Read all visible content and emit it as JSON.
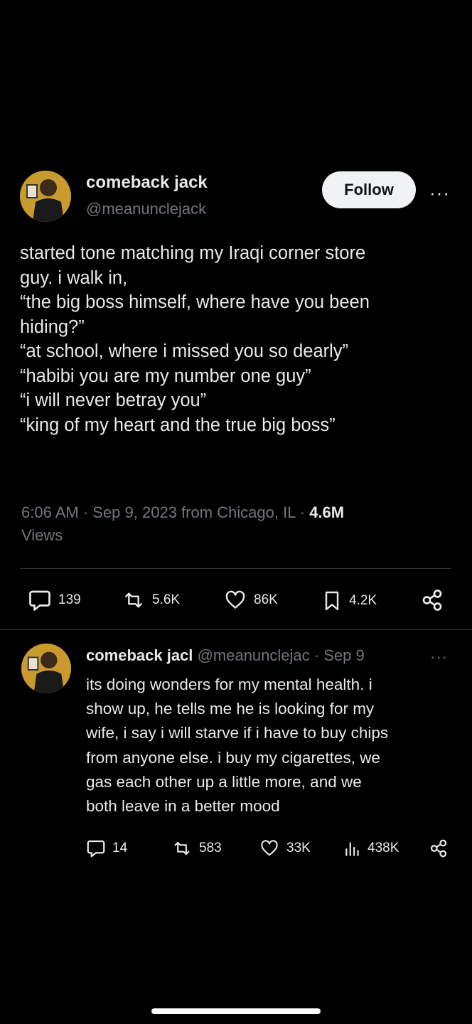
{
  "tweet": {
    "author_name": "comeback jack",
    "author_handle": "@meanunclejack",
    "follow_label": "Follow",
    "more_label": "···",
    "text": "started tone matching my Iraqi corner store\nguy. i walk in,\n“the big boss himself, where have you been\nhiding?”\n“at school, where i missed you so dearly”\n“habibi you are my number one guy”\n“i will never betray you”\n“king of my heart and the true big boss”",
    "timestamp": "6:06 AM · Sep 9, 2023 from Chicago, IL · ",
    "views_count": "4.6M",
    "views_label": "Views",
    "replies": "139",
    "retweets": "5.6K",
    "likes": "86K",
    "bookmarks": "4.2K"
  },
  "reply": {
    "author_name": "comeback jacl",
    "author_handle": "@meanunclejac",
    "date": "· Sep 9",
    "more_label": "···",
    "text": "its doing wonders for my mental health. i\nshow up, he tells me he is looking for my\nwife, i say i will starve if i have to buy chips\nfrom anyone else. i buy my cigarettes, we\ngas each other up a little more, and we\nboth leave in a better mood",
    "replies": "14",
    "retweets": "583",
    "likes": "33K",
    "views": "438K"
  },
  "colors": {
    "background": "#000000",
    "text": "#e7e9ea",
    "muted": "#71767b",
    "divider": "#2f3336",
    "follow_bg": "#eff3f4"
  }
}
